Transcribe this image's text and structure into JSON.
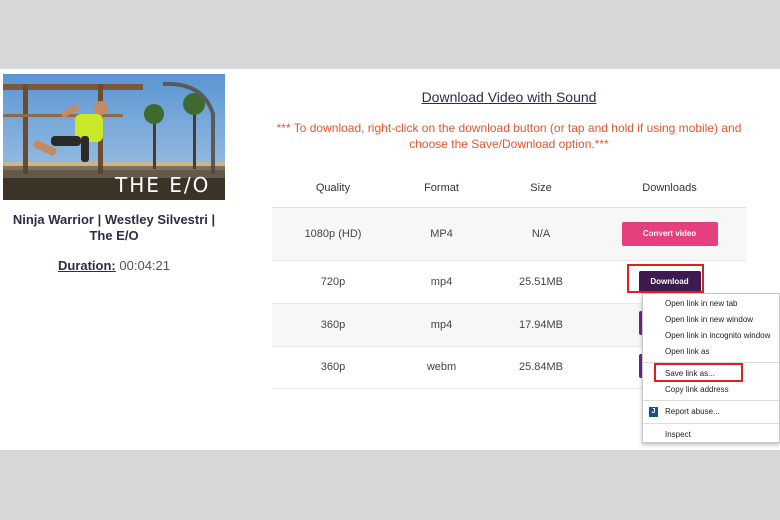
{
  "video": {
    "thumbnail_caption": "THE E/O",
    "title": "Ninja Warrior | Westley Silvestri | The E/O",
    "duration_label": "Duration:",
    "duration_value": "00:04:21"
  },
  "downloads": {
    "heading": "Download Video with Sound",
    "notice": "*** To download, right-click on the download button (or tap and hold if using mobile) and choose the Save/Download option.***",
    "columns": [
      "Quality",
      "Format",
      "Size",
      "Downloads"
    ],
    "rows": [
      {
        "quality": "1080p (HD)",
        "format": "MP4",
        "size": "N/A",
        "action": "Convert video"
      },
      {
        "quality": "720p",
        "format": "mp4",
        "size": "25.51MB",
        "action": "Download"
      },
      {
        "quality": "360p",
        "format": "mp4",
        "size": "17.94MB",
        "action": ""
      },
      {
        "quality": "360p",
        "format": "webm",
        "size": "25.84MB",
        "action": ""
      }
    ]
  },
  "context_menu": {
    "items": [
      "Open link in new tab",
      "Open link in new window",
      "Open link in incognito window",
      "Open link as",
      "Save link as...",
      "Copy link address",
      "Report abuse...",
      "Inspect"
    ],
    "report_icon_letter": "J"
  },
  "colors": {
    "accent_orange": "#e3562f",
    "convert_pink": "#e5407d",
    "download_dark": "#3d1b4e",
    "highlight_red": "#e02020"
  }
}
